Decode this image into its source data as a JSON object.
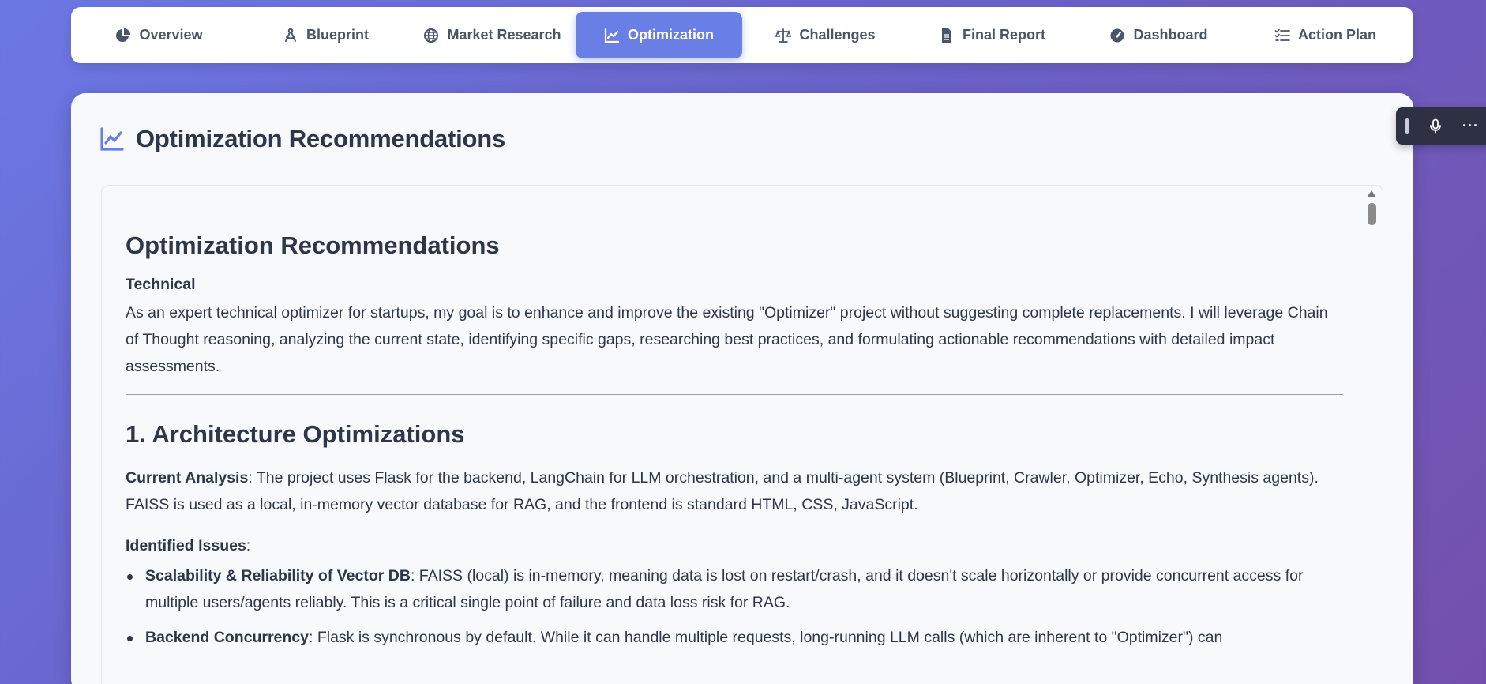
{
  "nav": {
    "tabs": [
      {
        "label": "Overview",
        "icon": "chart-pie-icon"
      },
      {
        "label": "Blueprint",
        "icon": "compass-icon"
      },
      {
        "label": "Market Research",
        "icon": "globe-icon"
      },
      {
        "label": "Optimization",
        "icon": "chart-line-icon",
        "active": true
      },
      {
        "label": "Challenges",
        "icon": "balance-scale-icon"
      },
      {
        "label": "Final Report",
        "icon": "file-icon"
      },
      {
        "label": "Dashboard",
        "icon": "gauge-icon"
      },
      {
        "label": "Action Plan",
        "icon": "tasks-icon"
      }
    ]
  },
  "card": {
    "title": "Optimization Recommendations",
    "icon": "chart-line-icon"
  },
  "report": {
    "heading": "Optimization Recommendations",
    "technical_label": "Technical",
    "intro": "As an expert technical optimizer for startups, my goal is to enhance and improve the existing \"Optimizer\" project without suggesting complete replacements. I will leverage Chain of Thought reasoning, analyzing the current state, identifying specific gaps, researching best practices, and formulating actionable recommendations with detailed impact assessments.",
    "section1_heading": "1. Architecture Optimizations",
    "current_analysis_label": "Current Analysis",
    "current_analysis_text": ": The project uses Flask for the backend, LangChain for LLM orchestration, and a multi-agent system (Blueprint, Crawler, Optimizer, Echo, Synthesis agents). FAISS is used as a local, in-memory vector database for RAG, and the frontend is standard HTML, CSS, JavaScript.",
    "identified_issues_label": "Identified Issues",
    "identified_issues_colon": ":",
    "issues": [
      {
        "title": "Scalability & Reliability of Vector DB",
        "text": ": FAISS (local) is in-memory, meaning data is lost on restart/crash, and it doesn't scale horizontally or provide concurrent access for multiple users/agents reliably. This is a critical single point of failure and data loss risk for RAG."
      },
      {
        "title": "Backend Concurrency",
        "text": ": Flask is synchronous by default. While it can handle multiple requests, long-running LLM calls (which are inherent to \"Optimizer\") can"
      }
    ]
  },
  "colors": {
    "accent": "#6a7fe6",
    "toolbar": "#2e3144"
  },
  "toolbar": {
    "icons": [
      "grip-icon",
      "microphone-icon",
      "more-icon"
    ],
    "more_label": "···"
  }
}
